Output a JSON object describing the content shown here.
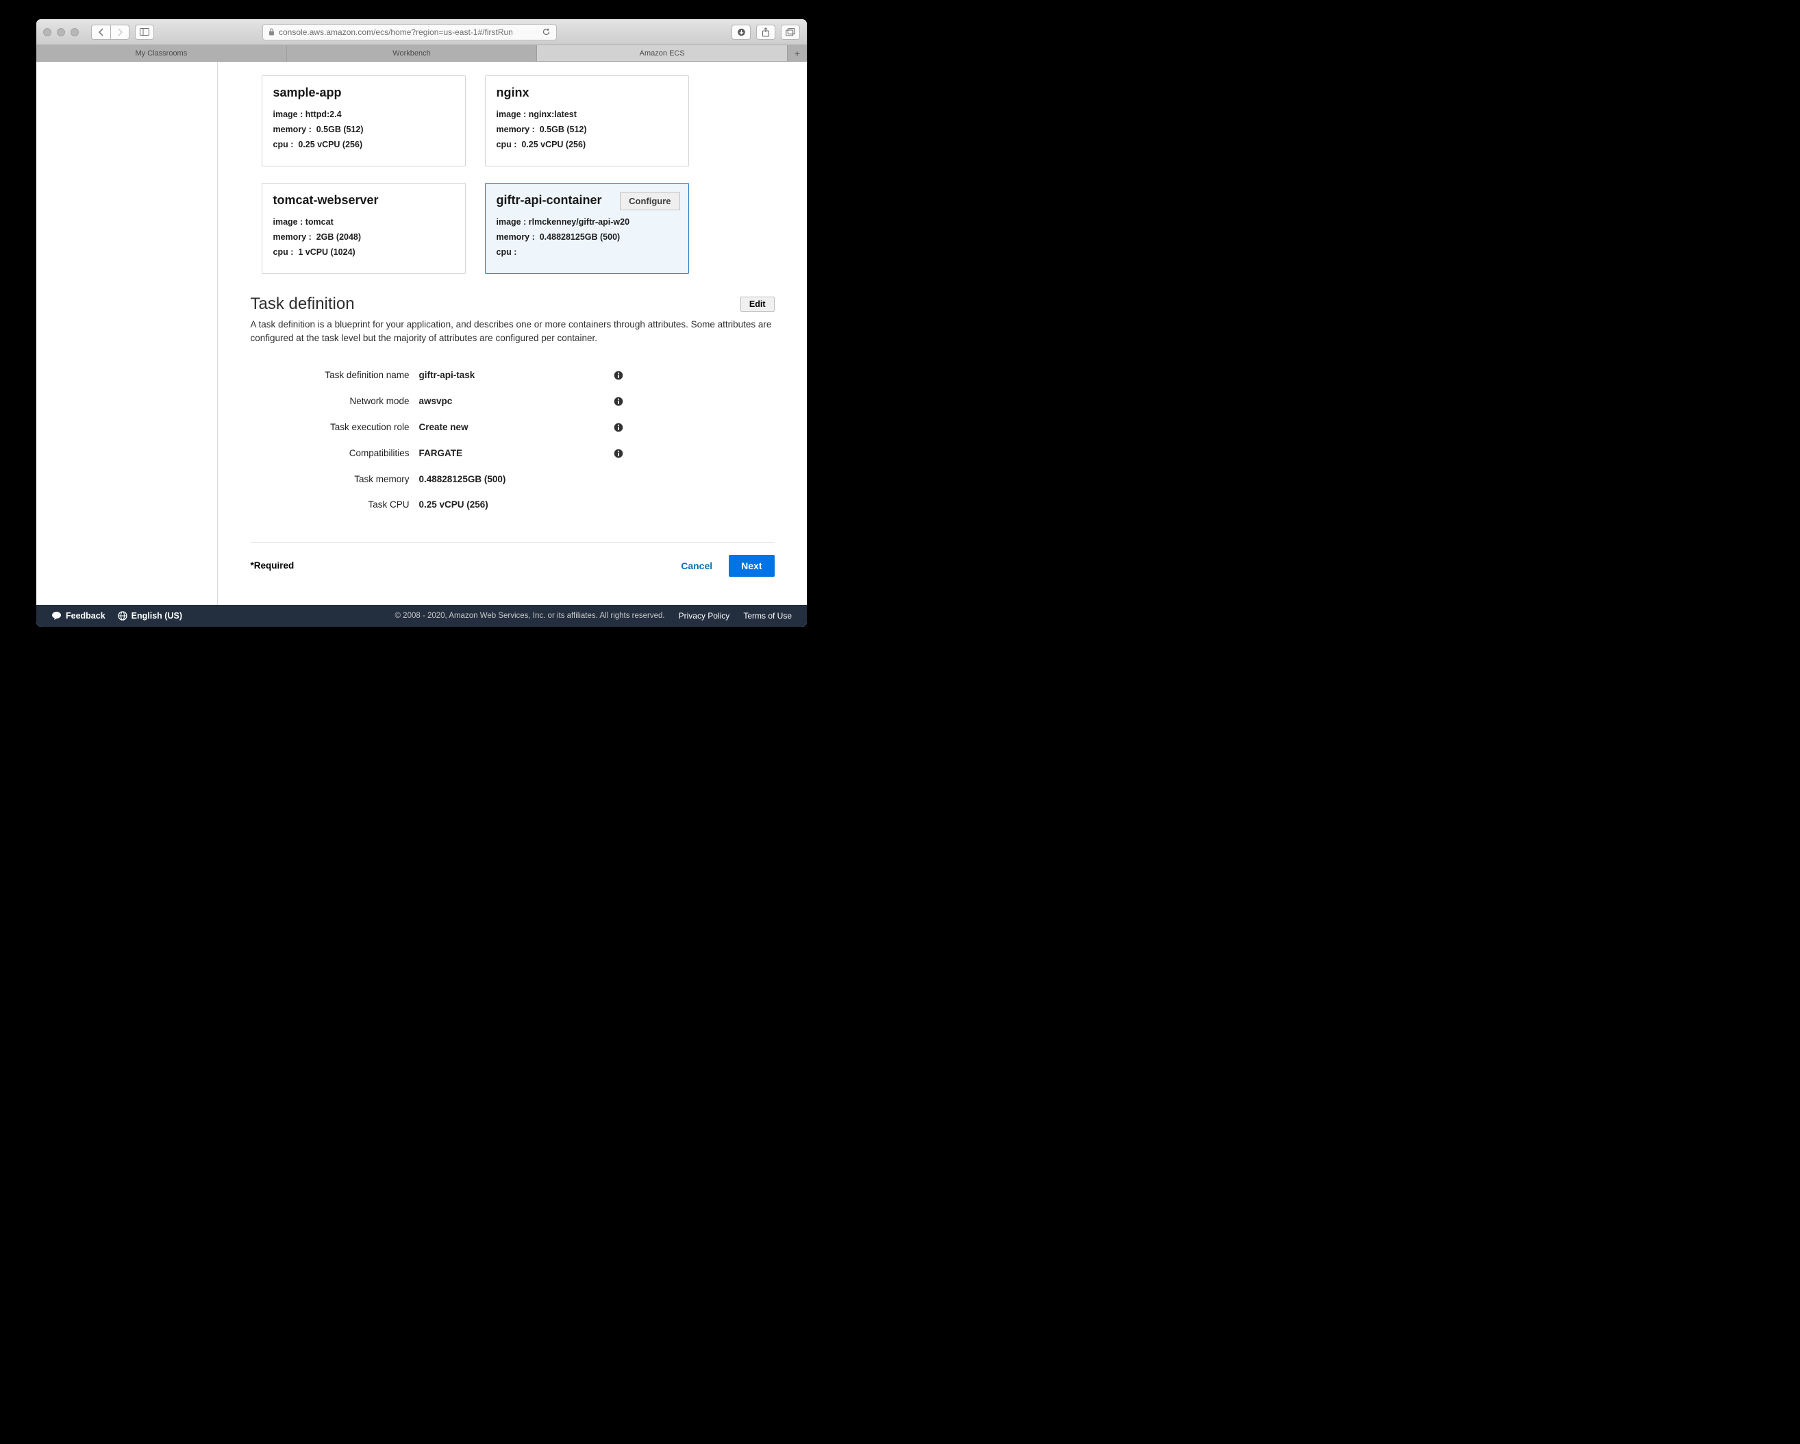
{
  "browser": {
    "url": "console.aws.amazon.com/ecs/home?region=us-east-1#/firstRun",
    "tabs": [
      "My Classrooms",
      "Workbench",
      "Amazon ECS"
    ],
    "active_tab_index": 2
  },
  "containers": [
    {
      "name": "sample-app",
      "image_label": "image :",
      "image": "httpd:2.4",
      "memory_label": "memory :",
      "memory": "0.5GB (512)",
      "cpu_label": "cpu :",
      "cpu": "0.25 vCPU (256)",
      "selected": false
    },
    {
      "name": "nginx",
      "image_label": "image :",
      "image": "nginx:latest",
      "memory_label": "memory :",
      "memory": "0.5GB (512)",
      "cpu_label": "cpu :",
      "cpu": "0.25 vCPU (256)",
      "selected": false
    },
    {
      "name": "tomcat-webserver",
      "image_label": "image :",
      "image": "tomcat",
      "memory_label": "memory :",
      "memory": "2GB (2048)",
      "cpu_label": "cpu :",
      "cpu": "1 vCPU (1024)",
      "selected": false
    },
    {
      "name": "giftr-api-container",
      "image_label": "image :",
      "image": "rlmckenney/giftr-api-w20",
      "memory_label": "memory :",
      "memory": "0.48828125GB (500)",
      "cpu_label": "cpu :",
      "cpu": "",
      "selected": true,
      "configure_label": "Configure"
    }
  ],
  "task_definition": {
    "heading": "Task definition",
    "edit_label": "Edit",
    "description": "A task definition is a blueprint for your application, and describes one or more containers through attributes. Some attributes are configured at the task level but the majority of attributes are configured per container.",
    "rows": [
      {
        "label": "Task definition name",
        "value": "giftr-api-task",
        "info": true
      },
      {
        "label": "Network mode",
        "value": "awsvpc",
        "info": true
      },
      {
        "label": "Task execution role",
        "value": "Create new",
        "info": true
      },
      {
        "label": "Compatibilities",
        "value": "FARGATE",
        "info": true
      },
      {
        "label": "Task memory",
        "value": "0.48828125GB (500)",
        "info": false
      },
      {
        "label": "Task CPU",
        "value": "0.25 vCPU (256)",
        "info": false
      }
    ]
  },
  "actions": {
    "required_label": "*Required",
    "cancel": "Cancel",
    "next": "Next"
  },
  "footer": {
    "feedback": "Feedback",
    "language": "English (US)",
    "copyright": "© 2008 - 2020, Amazon Web Services, Inc. or its affiliates. All rights reserved.",
    "privacy": "Privacy Policy",
    "terms": "Terms of Use"
  }
}
